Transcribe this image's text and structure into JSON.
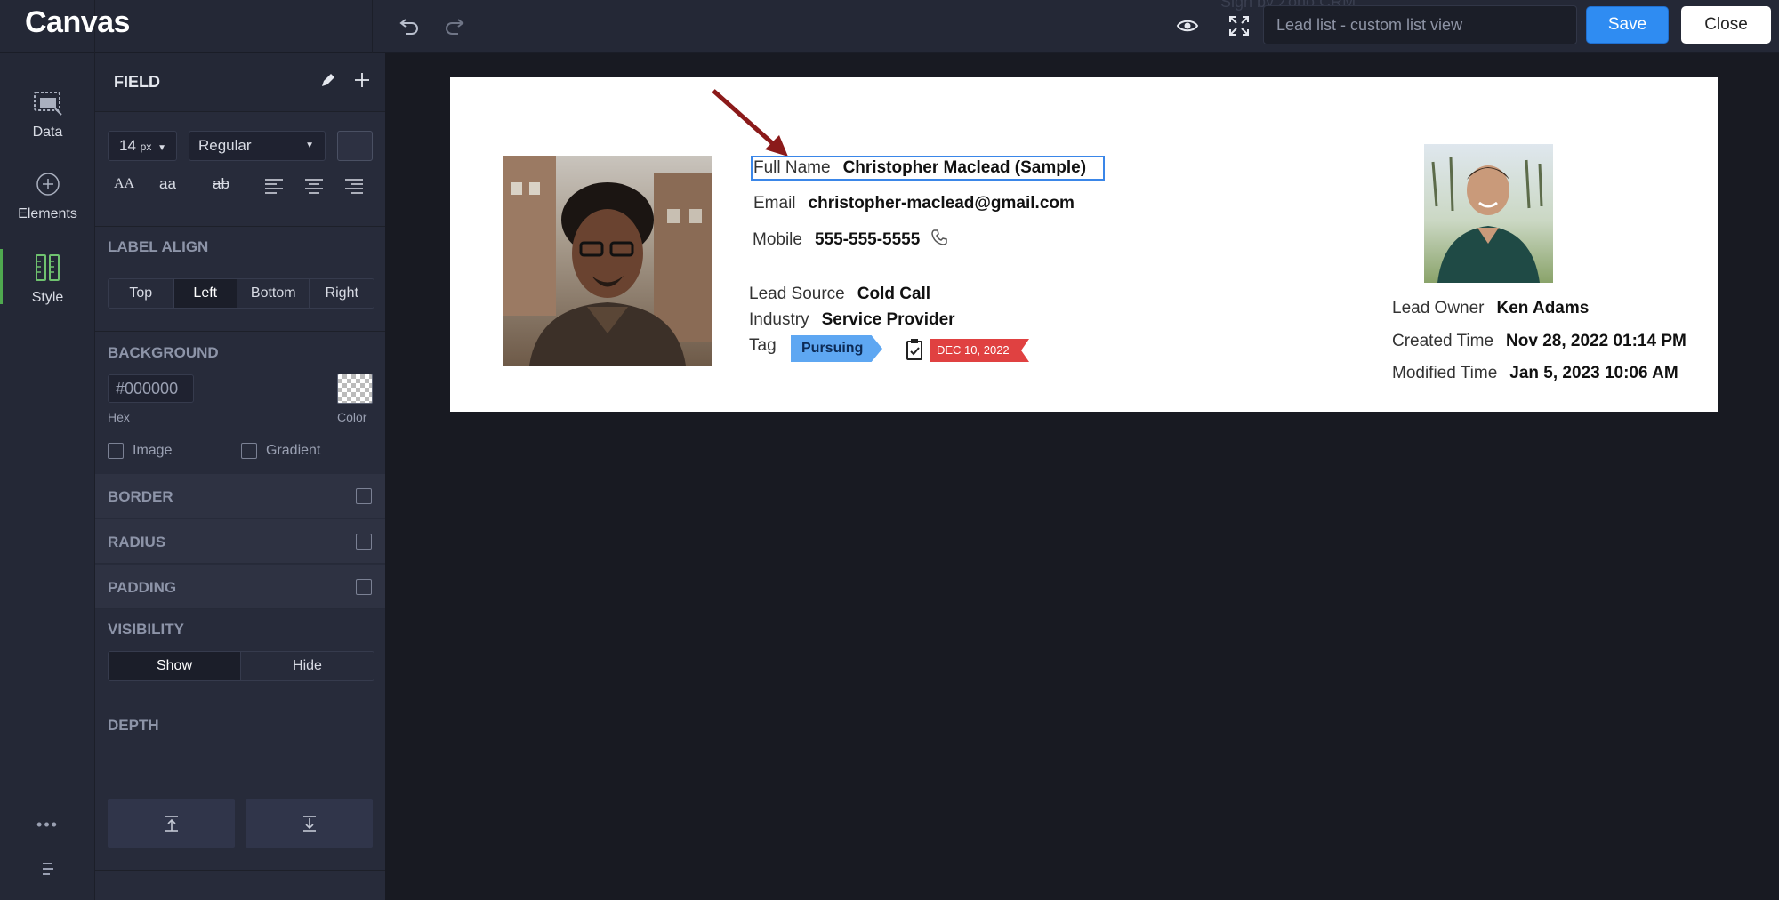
{
  "app": {
    "logo": "Canvas",
    "ghost_text": "Sign by Zoho CRM"
  },
  "topbar": {
    "view_name_placeholder": "Lead list - custom list view",
    "save_label": "Save",
    "close_label": "Close"
  },
  "rail": {
    "items": [
      {
        "label": "Data",
        "icon": "data-icon"
      },
      {
        "label": "Elements",
        "icon": "plus-circle-icon"
      },
      {
        "label": "Style",
        "icon": "style-icon"
      }
    ],
    "active": "Style"
  },
  "panel": {
    "title": "FIELD",
    "font_size": "14",
    "font_size_unit": "px",
    "font_weight": "Regular",
    "case_upper": "AA",
    "case_lower": "aa",
    "strike": "ab",
    "label_align": {
      "title": "LABEL ALIGN",
      "options": [
        "Top",
        "Left",
        "Bottom",
        "Right"
      ],
      "selected": "Left"
    },
    "background": {
      "title": "BACKGROUND",
      "hex_value": "#000000",
      "hex_label": "Hex",
      "color_label": "Color",
      "image_label": "Image",
      "gradient_label": "Gradient"
    },
    "border_label": "BORDER",
    "radius_label": "RADIUS",
    "padding_label": "PADDING",
    "visibility": {
      "title": "VISIBILITY",
      "options": [
        "Show",
        "Hide"
      ],
      "selected": "Show"
    },
    "depth_label": "DEPTH"
  },
  "card": {
    "full_name": {
      "label": "Full Name",
      "value": "Christopher Maclead (Sample)"
    },
    "email": {
      "label": "Email",
      "value": "christopher-maclead@gmail.com"
    },
    "mobile": {
      "label": "Mobile",
      "value": "555-555-5555"
    },
    "lead_source": {
      "label": "Lead Source",
      "value": "Cold Call"
    },
    "industry": {
      "label": "Industry",
      "value": "Service Provider"
    },
    "tag": {
      "label": "Tag",
      "value": "Pursuing",
      "date": "DEC 10, 2022"
    },
    "lead_owner": {
      "label": "Lead Owner",
      "value": "Ken Adams"
    },
    "created_time": {
      "label": "Created Time",
      "value": "Nov 28, 2022 01:14 PM"
    },
    "modified_time": {
      "label": "Modified Time",
      "value": "Jan 5, 2023 10:06 AM"
    }
  },
  "colors": {
    "accent": "#2f8cf2",
    "tag_blue": "#5ea7f2",
    "tag_red": "#e04141",
    "style_green": "#4fa94f",
    "arrow": "#8b1a1a"
  }
}
